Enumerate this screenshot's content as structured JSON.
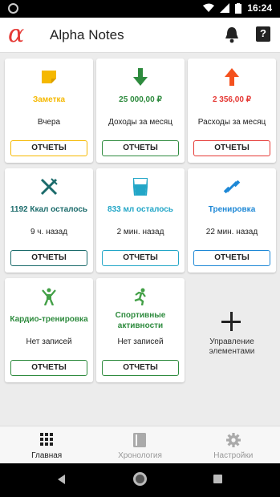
{
  "status": {
    "time": "16:24"
  },
  "app": {
    "logo": "α",
    "title": "Alpha Notes"
  },
  "colors": {
    "orange": "#f5b800",
    "green": "#2e8b3e",
    "red": "#e53935",
    "teal": "#1b6b6b",
    "cyan": "#22a6c7",
    "blue": "#1e88d6",
    "green2": "#43a047"
  },
  "cards": [
    {
      "value": "Заметка",
      "sub": "Вчера",
      "button": "ОТЧЕТЫ",
      "color": "#f5b800",
      "icon": "note-icon"
    },
    {
      "value": "25 000,00 ₽",
      "sub": "Доходы за месяц",
      "button": "ОТЧЕТЫ",
      "color": "#2e8b3e",
      "icon": "arrow-down-icon"
    },
    {
      "value": "2 356,00 ₽",
      "sub": "Расходы за месяц",
      "button": "ОТЧЕТЫ",
      "color": "#e53935",
      "icon": "arrow-up-icon"
    },
    {
      "value": "1192 Ккал осталось",
      "sub": "9 ч. назад",
      "button": "ОТЧЕТЫ",
      "color": "#1b6b6b",
      "icon": "food-icon"
    },
    {
      "value": "833 мл осталось",
      "sub": "2 мин. назад",
      "button": "ОТЧЕТЫ",
      "color": "#22a6c7",
      "icon": "water-glass-icon"
    },
    {
      "value": "Тренировка",
      "sub": "22 мин. назад",
      "button": "ОТЧЕТЫ",
      "color": "#1e88d6",
      "icon": "dumbbell-icon"
    },
    {
      "value": "Кардио-тренировка",
      "sub": "Нет записей",
      "button": "ОТЧЕТЫ",
      "color": "#2e8b3e",
      "icon": "person-jumping-icon"
    },
    {
      "value": "Спортивные активности",
      "sub": "Нет записей",
      "button": "ОТЧЕТЫ",
      "color": "#2e8b3e",
      "icon": "runner-icon"
    }
  ],
  "manage": {
    "label": "Управление элементами"
  },
  "nav": [
    {
      "label": "Главная",
      "active": true
    },
    {
      "label": "Хронология",
      "active": false
    },
    {
      "label": "Настройки",
      "active": false
    }
  ]
}
